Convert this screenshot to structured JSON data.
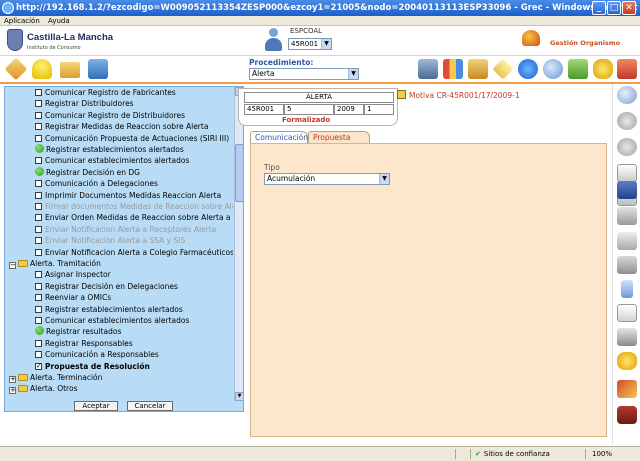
{
  "window": {
    "title": "http://192.168.1.2/?ezcodigo=W009052113354ZESP000&ezcoy1=21005&nodo=20040113113ESP33096 - Grec - Windows Internet Explorer",
    "menu": [
      "Aplicación",
      "Ayuda"
    ]
  },
  "header": {
    "logo_name": "Castilla-La Mancha",
    "logo_sub": "Instituto de Consumo",
    "user_code": "ESPCOAL",
    "user_select": "45R001",
    "gestion_label": "Gestión Organismo"
  },
  "toolbar": {
    "procedimiento_label": "Procedimiento:",
    "procedimiento_value": "Alerta"
  },
  "tree": {
    "items": [
      {
        "label": "Comunicar Registro de Fabricantes",
        "type": "checkbox"
      },
      {
        "label": "Registrar Distribuidores",
        "type": "checkbox"
      },
      {
        "label": "Comunicar Registro de Distribuidores",
        "type": "checkbox"
      },
      {
        "label": "Registrar Medidas de Reaccion sobre Alerta",
        "type": "checkbox"
      },
      {
        "label": "Comunicación Propuesta de Actuaciones (SIRI III)",
        "type": "checkbox"
      },
      {
        "label": "Registrar establecimientos alertados",
        "type": "done"
      },
      {
        "label": "Comunicar establecimientos alertados",
        "type": "checkbox"
      },
      {
        "label": "Registrar Decisión en DG",
        "type": "done"
      },
      {
        "label": "Comunicación a Delegaciones",
        "type": "checkbox"
      },
      {
        "label": "Imprimir Documentos Medidas Reaccion Alerta",
        "type": "checkbox"
      },
      {
        "label": "Firmar documentos Medidas de Reaccion sobre Alerta",
        "type": "disabled"
      },
      {
        "label": "Enviar Orden Medidas de Reaccion sobre Alerta a los F",
        "type": "checkbox"
      },
      {
        "label": "Enviar Notificacion Alerta a Receptores Alerta",
        "type": "disabled"
      },
      {
        "label": "Enviar Notificacion Alerta a SSA y SIS",
        "type": "disabled"
      },
      {
        "label": "Enviar Notificacion Alerta a Colegio Farmacéuticos",
        "type": "checkbox"
      },
      {
        "label": "Alerta. Tramitación",
        "type": "folder-open"
      },
      {
        "label": "Asignar Inspector",
        "type": "checkbox"
      },
      {
        "label": "Registrar Decisión en Delegaciones",
        "type": "checkbox"
      },
      {
        "label": "Reenviar a OMICs",
        "type": "checkbox"
      },
      {
        "label": "Registrar establecimientos alertados",
        "type": "checkbox"
      },
      {
        "label": "Comunicar establecimientos alertados",
        "type": "checkbox"
      },
      {
        "label": "Registrar resultados",
        "type": "done"
      },
      {
        "label": "Registrar Responsables",
        "type": "checkbox"
      },
      {
        "label": "Comunicación a Responsables",
        "type": "checkbox"
      },
      {
        "label": "Propuesta de Resolución",
        "type": "checked"
      },
      {
        "label": "Alerta. Terminación",
        "type": "folder-closed"
      },
      {
        "label": "Alerta. Otros",
        "type": "folder-closed"
      }
    ],
    "accept_label": "Aceptar",
    "cancel_label": "Cancelar"
  },
  "alert": {
    "header": "ALERTA",
    "cells": [
      "45R001",
      "5",
      "2009",
      "1"
    ],
    "status": "Formalizado",
    "motiva": "Motiva CR-45R001/17/2009-1"
  },
  "tabs": [
    "Comunicación",
    "Propuesta"
  ],
  "form": {
    "tipo_label": "Tipo",
    "tipo_value": "Acumulación"
  },
  "statusbar": {
    "trust": "Sitios de confianza",
    "zoom": "100%"
  },
  "colors": {
    "tree_bg": "#b9dcf6",
    "panel_bg": "#fde7cc",
    "accent_red": "#c0392b",
    "accent_blue": "#2e59a6"
  }
}
